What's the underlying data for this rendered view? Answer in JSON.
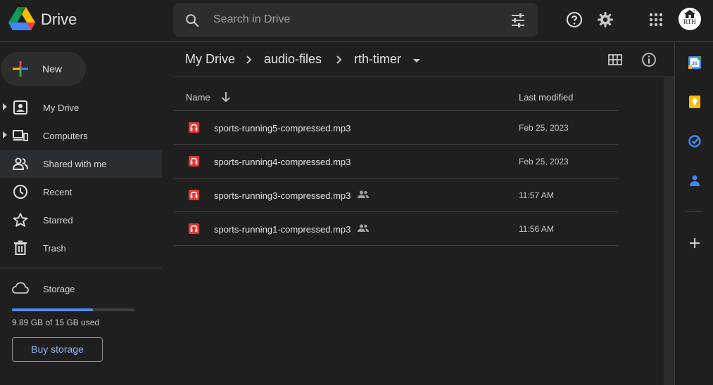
{
  "app": {
    "name": "Drive"
  },
  "search": {
    "placeholder": "Search in Drive"
  },
  "account": {
    "avatar_text": "RTH"
  },
  "sidebar": {
    "new_label": "New",
    "items": [
      {
        "label": "My Drive",
        "icon": "my-drive-icon",
        "expandable": true
      },
      {
        "label": "Computers",
        "icon": "computers-icon",
        "expandable": true
      },
      {
        "label": "Shared with me",
        "icon": "shared-icon",
        "expandable": false
      },
      {
        "label": "Recent",
        "icon": "clock-icon",
        "expandable": false
      },
      {
        "label": "Starred",
        "icon": "star-icon",
        "expandable": false
      },
      {
        "label": "Trash",
        "icon": "trash-icon",
        "expandable": false
      }
    ],
    "storage": {
      "label": "Storage",
      "usage_text": "9.89 GB of 15 GB used",
      "used_fraction": 0.66,
      "buy_label": "Buy storage"
    }
  },
  "breadcrumb": [
    "My Drive",
    "audio-files",
    "rth-timer"
  ],
  "table": {
    "headers": {
      "name": "Name",
      "modified": "Last modified"
    },
    "rows": [
      {
        "name": "sports-running5-compressed.mp3",
        "shared": false,
        "modified": "Feb 25, 2023"
      },
      {
        "name": "sports-running4-compressed.mp3",
        "shared": false,
        "modified": "Feb 25, 2023"
      },
      {
        "name": "sports-running3-compressed.mp3",
        "shared": true,
        "modified": "11:57 AM"
      },
      {
        "name": "sports-running1-compressed.mp3",
        "shared": true,
        "modified": "11:56 AM"
      }
    ]
  },
  "colors": {
    "background": "#1f1f1f",
    "accent": "#8ab4f8",
    "storage_fill": "#4f8ef0",
    "audio_file": "#e53935"
  }
}
